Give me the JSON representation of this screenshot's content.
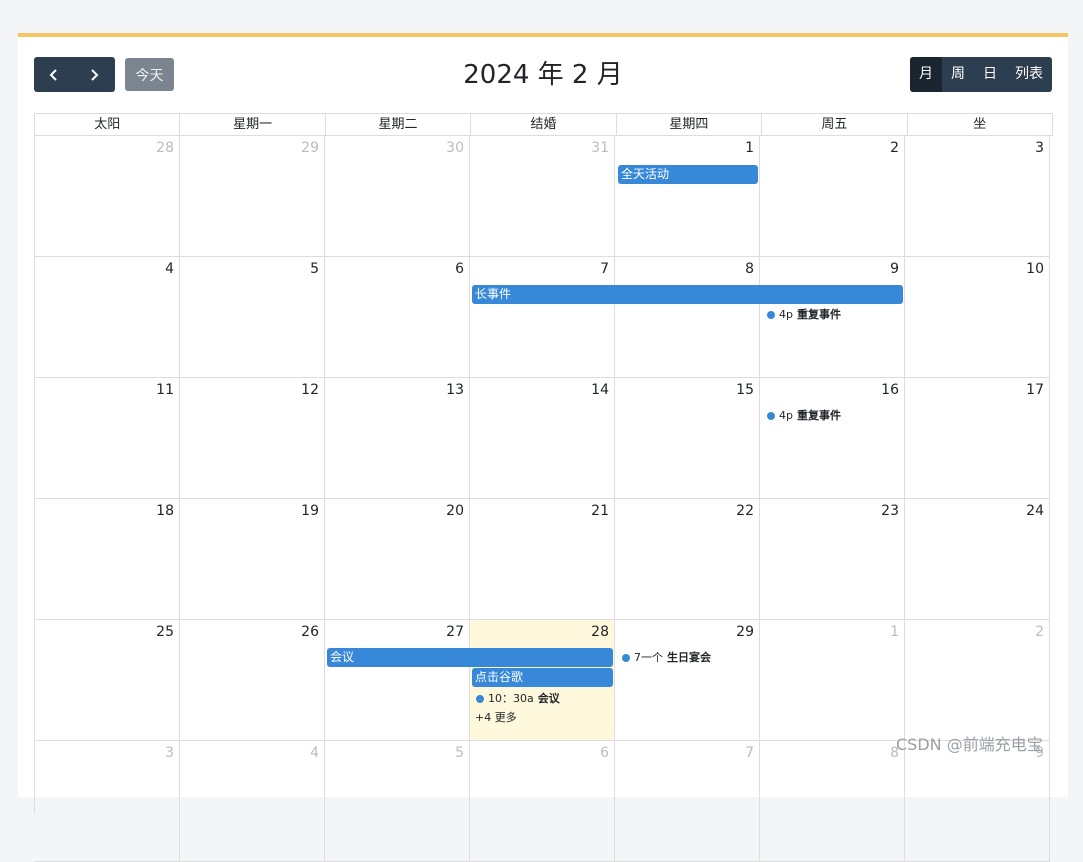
{
  "header": {
    "title": "2024 年 2 月",
    "today_label": "今天",
    "prev_icon": "chevron-left-icon",
    "next_icon": "chevron-right-icon",
    "views": [
      "月",
      "周",
      "日",
      "列表"
    ]
  },
  "weekdays": [
    "太阳",
    "星期一",
    "星期二",
    "结婚",
    "星期四",
    "周五",
    "坐"
  ],
  "weeks": [
    [
      "28",
      "29",
      "30",
      "31",
      "1",
      "2",
      "3"
    ],
    [
      "4",
      "5",
      "6",
      "7",
      "8",
      "9",
      "10"
    ],
    [
      "11",
      "12",
      "13",
      "14",
      "15",
      "16",
      "17"
    ],
    [
      "18",
      "19",
      "20",
      "21",
      "22",
      "23",
      "24"
    ],
    [
      "25",
      "26",
      "27",
      "28",
      "29",
      "1",
      "2"
    ],
    [
      "3",
      "4",
      "5",
      "6",
      "7",
      "8",
      "9"
    ]
  ],
  "events": {
    "all_day": "全天活动",
    "long_event": "长事件",
    "repeat_1_time": "4p",
    "repeat_1_title": "重复事件",
    "repeat_2_time": "4p",
    "repeat_2_title": "重复事件",
    "meeting_bar": "会议",
    "click_google": "点击谷歌",
    "meeting_time": "10：30a",
    "meeting_title": "会议",
    "more": "+4 更多",
    "birthday_time": "7一个",
    "birthday_title": "生日宴会"
  },
  "colors": {
    "accent_top": "#f5c563",
    "toolbar": "#2c3e50",
    "event": "#3788d8",
    "today_bg": "#fef8dc"
  },
  "watermark": "CSDN @前端充电宝"
}
